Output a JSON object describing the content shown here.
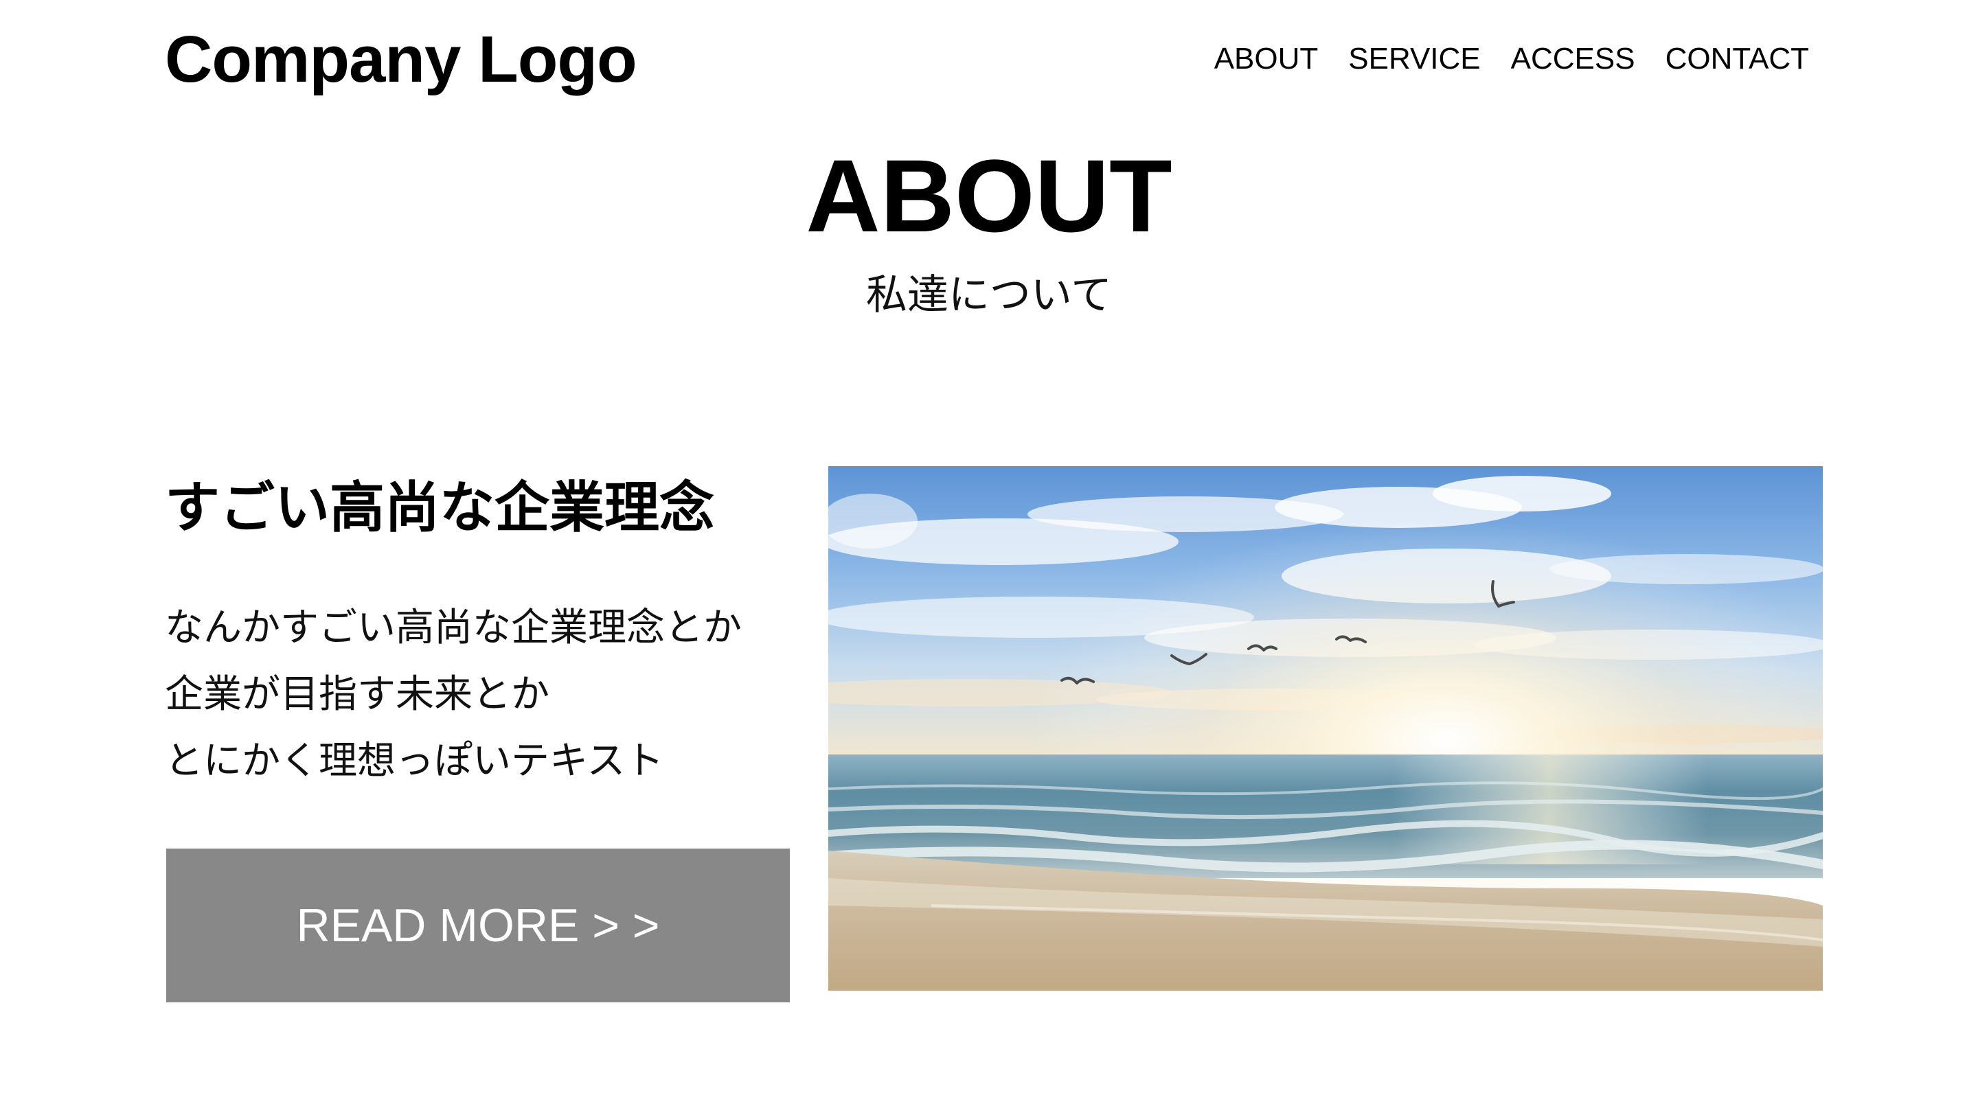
{
  "header": {
    "logo": "Company Logo",
    "nav": [
      "ABOUT",
      "SERVICE",
      "ACCESS",
      "CONTACT"
    ]
  },
  "section": {
    "title": "ABOUT",
    "subtitle": "私達について"
  },
  "content": {
    "headline": "すごい高尚な企業理念",
    "body_lines": [
      "なんかすごい高尚な企業理念とか",
      "企業が目指す未来とか",
      "とにかく理想っぽいテキスト"
    ],
    "button_label": "READ MORE > >"
  },
  "image": {
    "subject": "beach-sunrise-with-seagulls"
  },
  "colors": {
    "background": "#ffffff",
    "text": "#000000",
    "button_background": "#888888",
    "button_text": "#ffffff"
  }
}
